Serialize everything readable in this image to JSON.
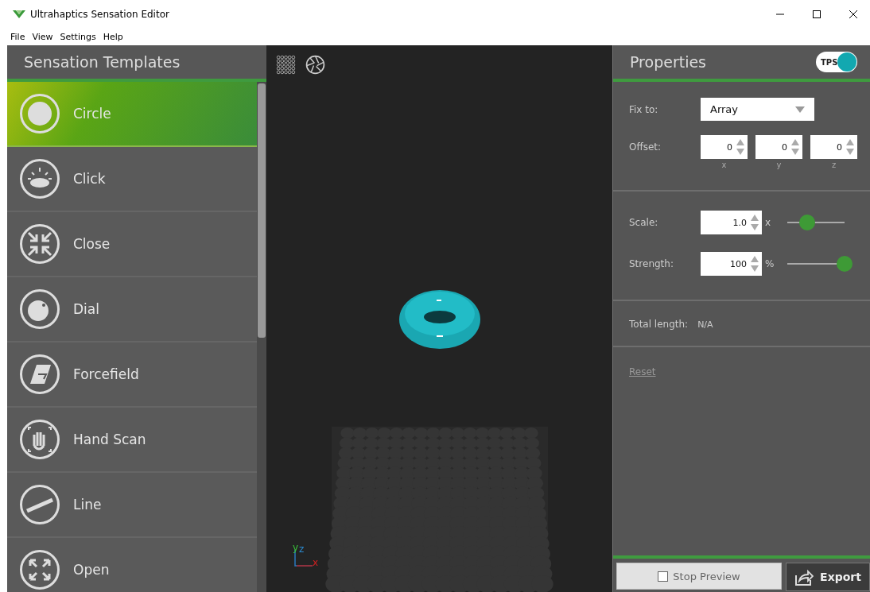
{
  "window": {
    "title": "Ultrahaptics Sensation Editor"
  },
  "menu": [
    "File",
    "View",
    "Settings",
    "Help"
  ],
  "templates": {
    "title": "Sensation Templates",
    "items": [
      {
        "label": "Circle",
        "selected": true
      },
      {
        "label": "Click",
        "selected": false
      },
      {
        "label": "Close",
        "selected": false
      },
      {
        "label": "Dial",
        "selected": false
      },
      {
        "label": "Forcefield",
        "selected": false
      },
      {
        "label": "Hand Scan",
        "selected": false
      },
      {
        "label": "Line",
        "selected": false
      },
      {
        "label": "Open",
        "selected": false
      }
    ]
  },
  "viewport": {
    "axes": [
      "y",
      "z",
      "x"
    ]
  },
  "properties": {
    "title": "Properties",
    "tps": {
      "label": "TPS",
      "on": true
    },
    "fix_to": {
      "label": "Fix to:",
      "value": "Array"
    },
    "offset": {
      "label": "Offset:",
      "fields": [
        {
          "value": "0",
          "axis": "x"
        },
        {
          "value": "0",
          "axis": "y"
        },
        {
          "value": "0",
          "axis": "z"
        }
      ]
    },
    "sliders": [
      {
        "label": "Scale:",
        "value": "1.0",
        "unit": "x",
        "level": 0.35
      },
      {
        "label": "Strength:",
        "value": "100",
        "unit": "%",
        "level": 1
      }
    ],
    "total_length": {
      "label": "Total length:",
      "value": "N/A"
    },
    "reset": "Reset"
  },
  "footer": {
    "stop_preview": {
      "label": "Stop Preview",
      "checked": false
    },
    "export": "Export"
  }
}
